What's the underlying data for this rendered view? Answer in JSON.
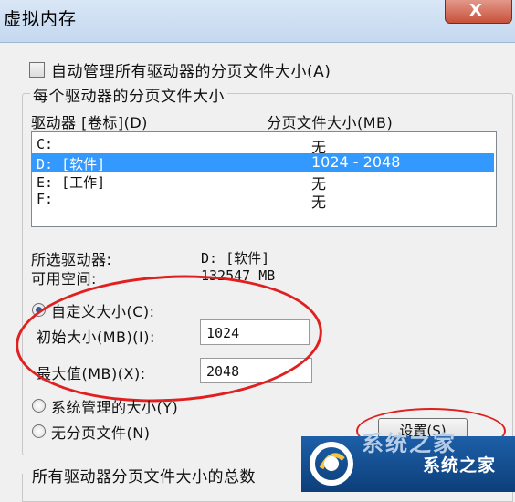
{
  "window": {
    "title": "虚拟内存",
    "close_label": "X"
  },
  "auto_manage": {
    "label": "自动管理所有驱动器的分页文件大小(A)",
    "checked": false
  },
  "per_drive": {
    "group_title": "每个驱动器的分页文件大小",
    "col_drive": "驱动器 [卷标](D)",
    "col_size": "分页文件大小(MB)",
    "drives": [
      {
        "drive": "C:",
        "size": "无",
        "selected": false
      },
      {
        "drive": "D:  [软件]",
        "size": "1024 - 2048",
        "selected": true
      },
      {
        "drive": "E:  [工作]",
        "size": "无",
        "selected": false
      },
      {
        "drive": "F:",
        "size": "无",
        "selected": false
      }
    ]
  },
  "selected_drive": {
    "label": "所选驱动器:",
    "value": "D:  [软件]"
  },
  "free_space": {
    "label": "可用空间:",
    "value": "132547 MB"
  },
  "custom_size": {
    "label": "自定义大小(C):",
    "selected": true
  },
  "initial_size": {
    "label": "初始大小(MB)(I):",
    "value": "1024"
  },
  "max_size": {
    "label": "最大值(MB)(X):",
    "value": "2048"
  },
  "system_managed": {
    "label": "系统管理的大小(Y)",
    "selected": false
  },
  "no_paging": {
    "label": "无分页文件(N)",
    "selected": false
  },
  "set_button": {
    "label": "设置(S)"
  },
  "total": {
    "group_title": "所有驱动器分页文件大小的总数"
  },
  "watermark": {
    "text": "系统之家",
    "ghost": "系统之家"
  }
}
